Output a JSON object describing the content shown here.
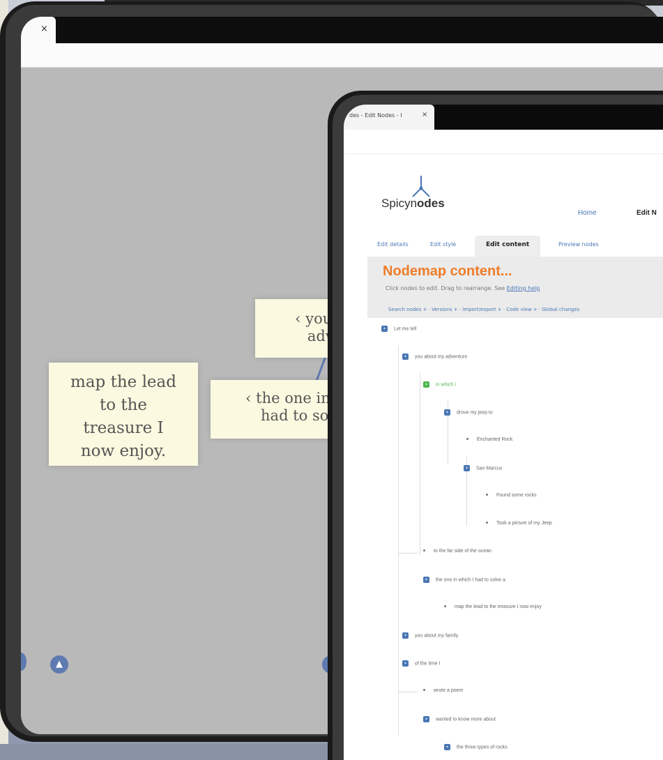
{
  "background": {
    "colors": {
      "desk": "#8a93a6",
      "paper": "#e9e6dc"
    }
  },
  "back_tablet": {
    "close_label": "×",
    "notes": {
      "lead_note": [
        "map the lead",
        "to the",
        "treasure I",
        "now enjoy."
      ],
      "one_note": [
        "the one in wh",
        "had to solv"
      ],
      "you_note": [
        "you ab",
        "adve"
      ],
      "lead_arrow": "‹",
      "you_arrow": "‹"
    },
    "nav_left_icon": "up-arrow-icon",
    "nav_left_glyph": "▲",
    "nav_right_icon": "circle-button-icon",
    "nav_right_glyph": ""
  },
  "front_tablet": {
    "browser_tab": {
      "title": "des - Edit Nodes - I",
      "close": "×"
    },
    "logo": {
      "text_pre": "Spicyn",
      "text_post": "odes"
    },
    "top_nav": {
      "home": "Home",
      "edit": "Edit N"
    },
    "content_tabs": [
      "Edit details",
      "Edit style",
      "Edit content",
      "Preview nodes"
    ],
    "active_tab": "Edit content",
    "panel": {
      "title": "Nodemap content...",
      "subtitle_pre": "Click nodes to edit. Drag to rearrange. See ",
      "subtitle_link": "Editing help",
      "toolbar": "Search nodes + · Versions + · Import/export + · Code view + · Global changes"
    },
    "tree_items": [
      {
        "label": "Let me tell",
        "kind": "box"
      },
      {
        "label": "you about my adventure",
        "kind": "box"
      },
      {
        "label": "in which i",
        "kind": "green"
      },
      {
        "label": "drove my jeep to",
        "kind": "box"
      },
      {
        "label": "Enchanted Rock",
        "kind": "dot"
      },
      {
        "label": "San Marcus",
        "kind": "box"
      },
      {
        "label": "Found some rocks",
        "kind": "dot"
      },
      {
        "label": "Took a picture of my Jeep",
        "kind": "dot"
      },
      {
        "label": "to the far side of the ocean",
        "kind": "dot"
      },
      {
        "label": "the one in which I had to solve a",
        "kind": "box"
      },
      {
        "label": "map the lead to the treasure I now enjoy",
        "kind": "dot"
      },
      {
        "label": "you about my family",
        "kind": "box"
      },
      {
        "label": "of the time I",
        "kind": "box"
      },
      {
        "label": "wrote a poem",
        "kind": "dot"
      },
      {
        "label": "wanted to know more about",
        "kind": "box"
      },
      {
        "label": "the three types of rocks",
        "kind": "box"
      }
    ],
    "colors": {
      "accent_orange": "#ee7d2a",
      "link_blue": "#4a77b4",
      "node_green": "#4fb74f"
    }
  }
}
